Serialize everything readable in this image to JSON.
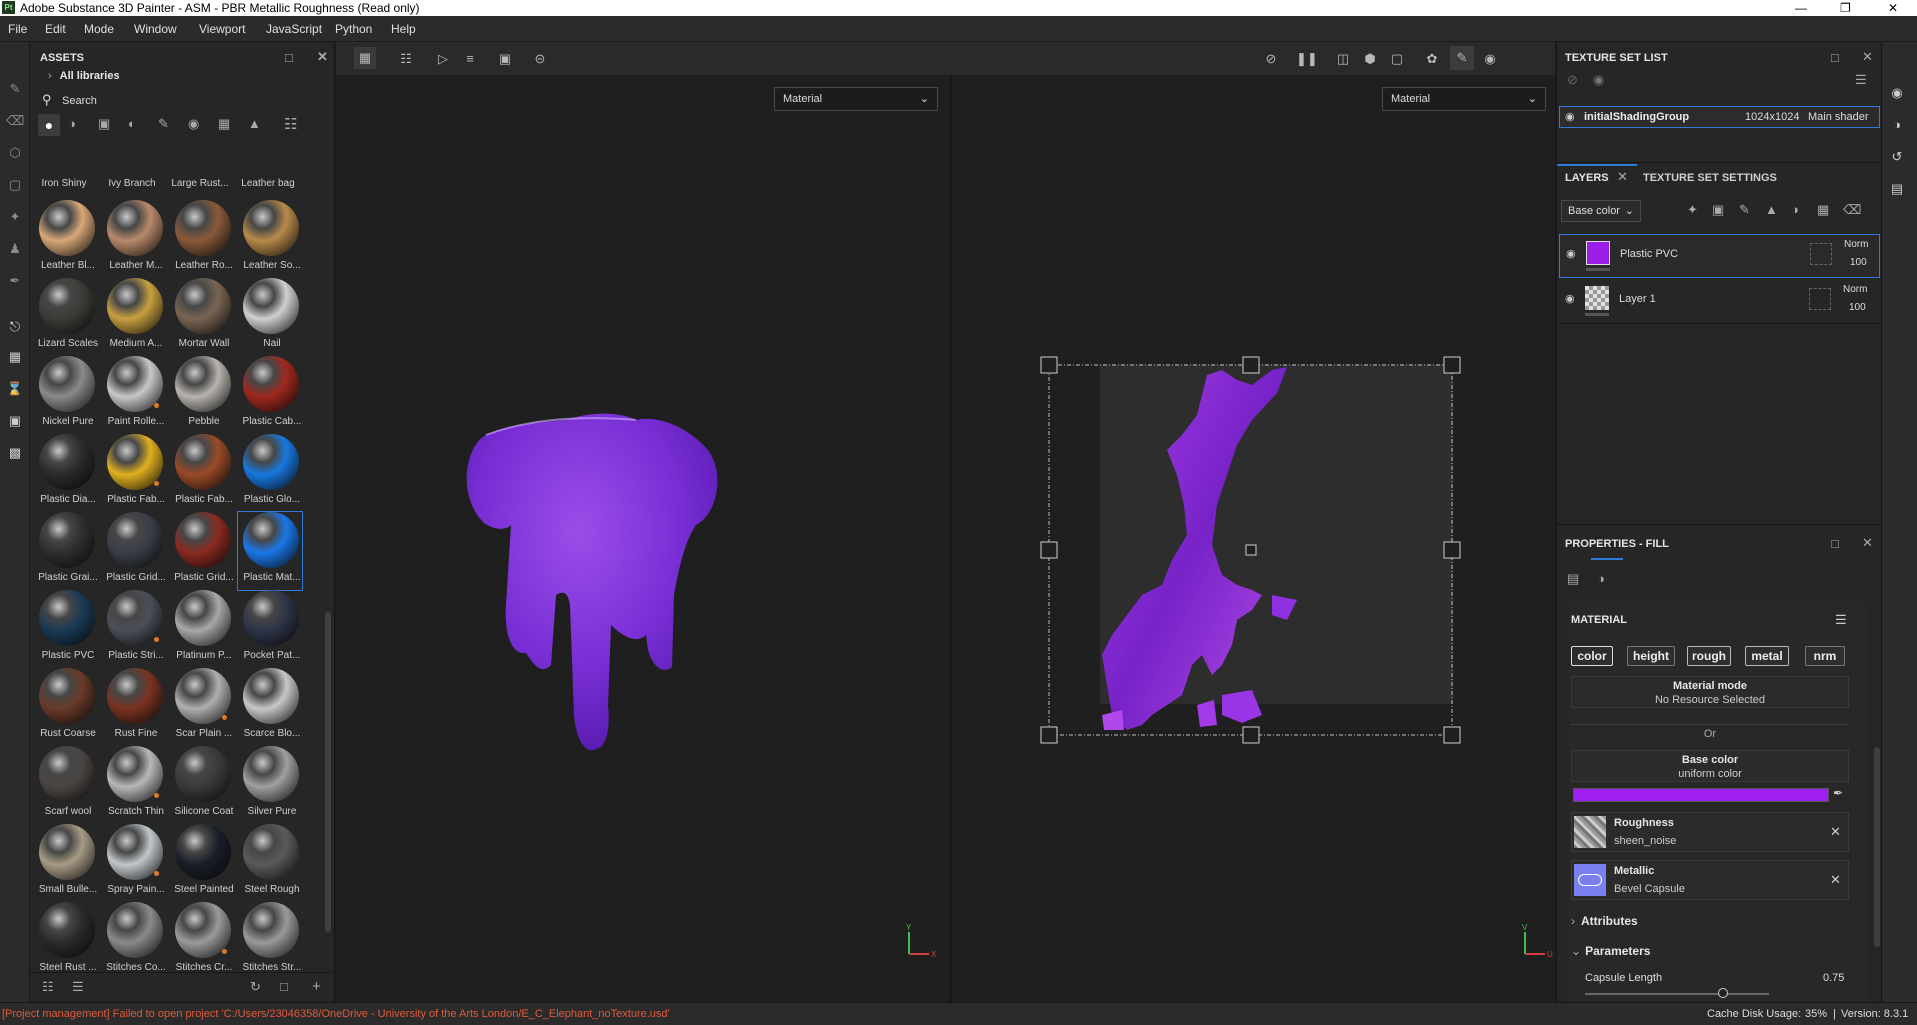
{
  "window": {
    "title": "Adobe Substance 3D Painter - ASM - PBR Metallic Roughness (Read only)",
    "logo_text": "Pt"
  },
  "menu": [
    "File",
    "Edit",
    "Mode",
    "Window",
    "Viewport",
    "JavaScript",
    "Python",
    "Help"
  ],
  "assets": {
    "title": "ASSETS",
    "library": "All libraries",
    "search_placeholder": "Search",
    "top_row_labels": [
      "Iron Shiny",
      "Ivy Branch",
      "Large Rust...",
      "Leather bag"
    ],
    "materials": [
      {
        "label": "Leather Bl...",
        "color": "#d8a878"
      },
      {
        "label": "Leather M...",
        "color": "#b88a6a"
      },
      {
        "label": "Leather Ro...",
        "color": "#8a5a3a"
      },
      {
        "label": "Leather So...",
        "color": "#b88a4a"
      },
      {
        "label": "Lizard Scales",
        "color": "#3a3d36"
      },
      {
        "label": "Medium A...",
        "color": "#c8a040"
      },
      {
        "label": "Mortar Wall",
        "color": "#7a6552"
      },
      {
        "label": "Nail",
        "color": "#d0d0d0"
      },
      {
        "label": "Nickel Pure",
        "color": "#8a8a8a"
      },
      {
        "label": "Paint Rolle...",
        "color": "#c8c8c8"
      },
      {
        "label": "Pebble",
        "color": "#b8b4ae"
      },
      {
        "label": "Plastic Cab...",
        "color": "#a0281e"
      },
      {
        "label": "Plastic Dia...",
        "color": "#2a2a2a"
      },
      {
        "label": "Plastic Fab...",
        "color": "#e0b020"
      },
      {
        "label": "Plastic Fab...",
        "color": "#9a4a28"
      },
      {
        "label": "Plastic Glo...",
        "color": "#1878e0"
      },
      {
        "label": "Plastic Grai...",
        "color": "#2e2e2e"
      },
      {
        "label": "Plastic Grid...",
        "color": "#3a3e48"
      },
      {
        "label": "Plastic Grid...",
        "color": "#8a2a20"
      },
      {
        "label": "Plastic Mat...",
        "color": "#1a78e8"
      },
      {
        "label": "Plastic PVC",
        "color": "#1a3a55"
      },
      {
        "label": "Plastic Stri...",
        "color": "#4a4e58"
      },
      {
        "label": "Platinum P...",
        "color": "#a8a8a8"
      },
      {
        "label": "Pocket Pat...",
        "color": "#2e3448"
      },
      {
        "label": "Rust Coarse",
        "color": "#6a3a28"
      },
      {
        "label": "Rust Fine",
        "color": "#7a3222"
      },
      {
        "label": "Scar Plain ...",
        "color": "#b0b0b0"
      },
      {
        "label": "Scarce Blo...",
        "color": "#c8c8c8"
      },
      {
        "label": "Scarf wool",
        "color": "#4a4542"
      },
      {
        "label": "Scratch Thin",
        "color": "#b8b8b8"
      },
      {
        "label": "Silicone Coat",
        "color": "#3a3a3a"
      },
      {
        "label": "Silver Pure",
        "color": "#a0a0a0"
      },
      {
        "label": "Small Bulle...",
        "color": "#a89c86"
      },
      {
        "label": "Spray Pain...",
        "color": "#c0c8cc"
      },
      {
        "label": "Steel Painted",
        "color": "#1a1e28"
      },
      {
        "label": "Steel Rough",
        "color": "#5a5a5a"
      },
      {
        "label": "Steel Rust ...",
        "color": "#2a2a2a"
      },
      {
        "label": "Stitches Co...",
        "color": "#8a8a8a"
      },
      {
        "label": "Stitches Cr...",
        "color": "#9a9a9a"
      },
      {
        "label": "Stitches Str...",
        "color": "#9a9a9a"
      }
    ]
  },
  "viewport": {
    "left_mode": "Material",
    "right_mode": "Material",
    "axis_left": [
      "Y",
      "X"
    ],
    "axis_right": [
      "V",
      "U"
    ]
  },
  "texture_set_list": {
    "title": "TEXTURE SET LIST",
    "row": {
      "name": "initialShadingGroup",
      "size": "1024x1024",
      "shader": "Main shader"
    }
  },
  "layers": {
    "tabs": [
      "LAYERS",
      "TEXTURE SET SETTINGS"
    ],
    "channel": "Base color",
    "items": [
      {
        "name": "Plastic PVC",
        "blend": "Norm",
        "opacity": "100",
        "thumb_color": "#9b1ee6"
      },
      {
        "name": "Layer 1",
        "blend": "Norm",
        "opacity": "100",
        "thumb_color": "#cccccc"
      }
    ]
  },
  "properties": {
    "title": "PROPERTIES - FILL",
    "material_label": "MATERIAL",
    "channels": [
      "color",
      "height",
      "rough",
      "metal",
      "nrm"
    ],
    "material_mode_label": "Material mode",
    "material_mode_value": "No Resource Selected",
    "or_label": "Or",
    "base_color_label": "Base color",
    "base_color_sub": "uniform color",
    "base_color_value": "#a020f0",
    "roughness_label": "Roughness",
    "roughness_value": "sheen_noise",
    "metallic_label": "Metallic",
    "metallic_value": "Bevel Capsule",
    "attributes_label": "Attributes",
    "parameters_label": "Parameters",
    "capsule_length_label": "Capsule Length",
    "capsule_length_value": "0.75"
  },
  "status": {
    "message": "[Project management] Failed to open project 'C:/Users/23046358/OneDrive - University of the Arts London/E_C_Elephant_noTexture.usd'",
    "cache_label": "Cache Disk Usage:",
    "cache_value": "35%",
    "version": "Version: 8.3.1"
  },
  "colors": {
    "accent": "#2d7bd6",
    "purple": "#9b1ee6",
    "error": "#e05a3a"
  }
}
